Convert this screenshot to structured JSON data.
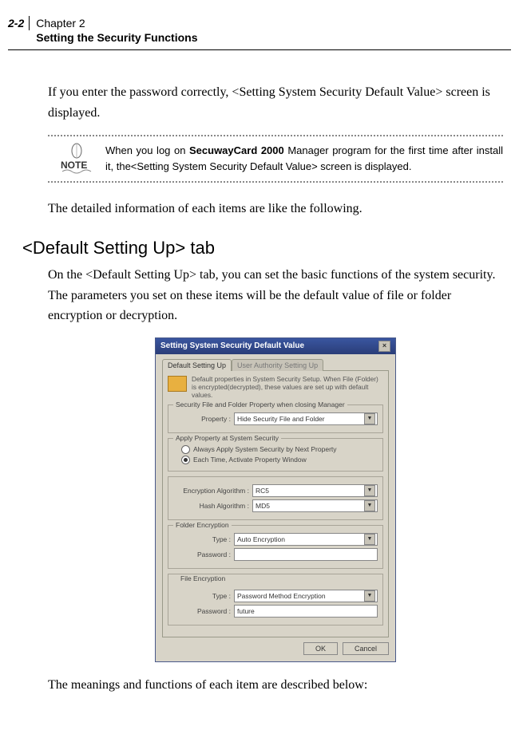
{
  "header": {
    "page_num": "2-2",
    "chapter": "Chapter 2",
    "subtitle": "Setting the Security Functions"
  },
  "body": {
    "para1": "If you enter the password correctly, <Setting System Security Default Value> screen is displayed.",
    "note_pre": "When you log on ",
    "note_bold": "SecuwayCard 2000",
    "note_post": " Manager program for the first time after install it, the<Setting System Security Default Value> screen is displayed.",
    "para2": "The detailed information of each items are like the following.",
    "section_heading": "<Default Setting Up> tab",
    "para3": "On the <Default Setting Up> tab, you can set the basic functions of the system security. The parameters you set on these items will be the default value of file or folder encryption or decryption.",
    "para4": "The meanings and functions of each item are described below:"
  },
  "dialog": {
    "title": "Setting System Security Default Value",
    "tab_active": "Default Setting Up",
    "tab_inactive": "User Authority Setting Up",
    "intro": "Default properties in System Security Setup. When File (Folder) is encrypted(decrypted), these values are set up with default values.",
    "group1": {
      "legend": "Security File and Folder Property when closing Manager",
      "label": "Property :",
      "value": "Hide Security File and Folder"
    },
    "group2": {
      "legend": "Apply Property at System Security",
      "opt1": "Always Apply System Security by Next Property",
      "opt2": "Each Time, Activate Property Window"
    },
    "alg": {
      "enc_label": "Encryption Algorithm :",
      "enc_value": "RC5",
      "hash_label": "Hash Algorithm :",
      "hash_value": "MD5"
    },
    "folder": {
      "legend": "Folder Encryption",
      "type_label": "Type :",
      "type_value": "Auto Encryption",
      "pwd_label": "Password :",
      "pwd_value": ""
    },
    "file": {
      "legend": "File Encryption",
      "type_label": "Type :",
      "type_value": "Password Method Encryption",
      "pwd_label": "Password :",
      "pwd_value": "future"
    },
    "buttons": {
      "ok": "OK",
      "cancel": "Cancel"
    }
  }
}
